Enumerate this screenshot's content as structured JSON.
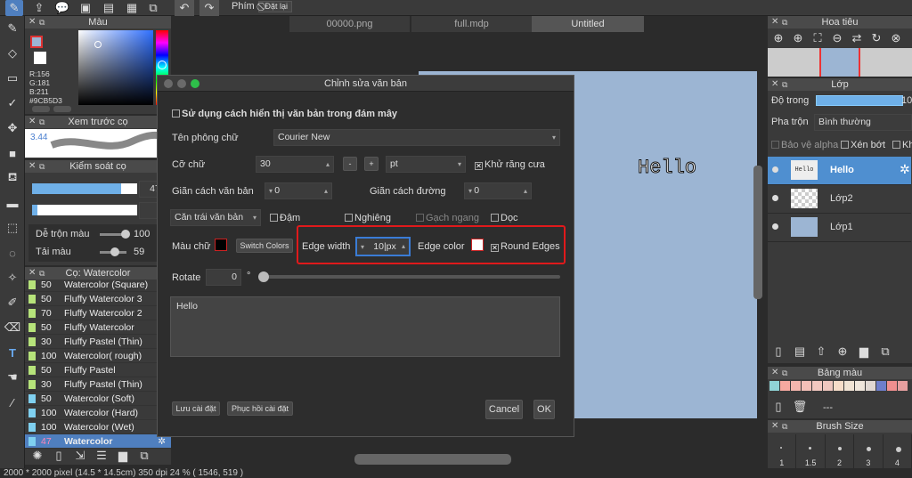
{
  "top_toolbar": {
    "snap_label": "Phím",
    "grid_button": "Đặt lại"
  },
  "tabs": [
    "00000.png",
    "full.mdp",
    "Untitled"
  ],
  "color_panel": {
    "title": "Màu",
    "r": "R:156",
    "g": "G:181",
    "b": "B:211",
    "hex": "#9CB5D3",
    "fg": "#9CB5D3",
    "bg": "#ffffff"
  },
  "preview_panel": {
    "title": "Xem trước cọ",
    "size": "3.44"
  },
  "brush_control": {
    "title": "Kiểm soát cọ",
    "size_value": "47",
    "opacity_value": "7",
    "blend_label": "Dễ trộn màu",
    "blend_value": "100",
    "load_label": "Tải màu",
    "load_value": "59",
    "size_frac": 0.85,
    "opacity_frac": 0.05,
    "blend_frac": 1.0,
    "load_frac": 0.59
  },
  "brush_list": {
    "title": "Cọ: Watercolor",
    "items": [
      {
        "n": "50",
        "name": "Watercolor (Square)"
      },
      {
        "n": "50",
        "name": "Fluffy Watercolor 3"
      },
      {
        "n": "70",
        "name": "Fluffy Watercolor 2"
      },
      {
        "n": "50",
        "name": "Fluffy Watercolor"
      },
      {
        "n": "30",
        "name": "Fluffy Pastel (Thin)"
      },
      {
        "n": "100",
        "name": "Watercolor( rough)"
      },
      {
        "n": "50",
        "name": "Fluffy Pastel"
      },
      {
        "n": "30",
        "name": "Fluffy Pastel (Thin)"
      },
      {
        "n": "50",
        "name": "Watercolor (Soft)"
      },
      {
        "n": "100",
        "name": "Watercolor (Hard)"
      },
      {
        "n": "100",
        "name": "Watercolor (Wet)"
      },
      {
        "n": "47",
        "name": "Watercolor"
      }
    ]
  },
  "status_bar": "2000 * 2000 pixel  (14.5 * 14.5cm)  350 dpi  24 %  ( 1546, 519 )",
  "canvas": {
    "text": "Hello",
    "bg": "#9CB5D3"
  },
  "dialog": {
    "title": "Chỉnh sửa văn bản",
    "cloud_font": "Sử dụng cách hiển thị văn bản trong đám mây",
    "font_label": "Tên phông chữ",
    "font_value": "Courier New",
    "size_label": "Cỡ chữ",
    "size_value": "30",
    "size_unit": "pt",
    "antialias": "Khử răng cưa",
    "char_spacing_label": "Giãn cách văn bản",
    "char_spacing_value": "0",
    "line_spacing_label": "Giãn cách đường",
    "line_spacing_value": "0",
    "align_value": "Căn trái văn bản",
    "bold": "Đậm",
    "italic": "Nghiêng",
    "strike": "Gạch ngang",
    "vertical": "Dọc",
    "color_label": "Màu chữ",
    "switch_colors": "Switch Colors",
    "edge_width_label": "Edge width",
    "edge_width_value": "10",
    "edge_width_unit": "px",
    "edge_color_label": "Edge color",
    "round_edges": "Round Edges",
    "rotate_label": "Rotate",
    "rotate_value": "0",
    "rotate_unit": "°",
    "text_content": "Hello",
    "save_settings": "Lưu cài đặt",
    "restore_settings": "Phục hồi cài đặt",
    "cancel": "Cancel",
    "ok": "OK"
  },
  "navigator": {
    "title": "Hoa tiêu"
  },
  "layers": {
    "title": "Lớp",
    "opacity_label": "Độ trong",
    "opacity_value": "10",
    "blend_label": "Pha trộn",
    "blend_value": "Bình thường",
    "protect_alpha": "Bảo vệ alpha",
    "clipping": "Xén bớt",
    "lock": "Kh",
    "items": [
      {
        "name": "Hello",
        "thumb": "Hello"
      },
      {
        "name": "Lớp2",
        "thumb": ""
      },
      {
        "name": "Lớp1",
        "thumb": ""
      }
    ]
  },
  "palette": {
    "title": "Bảng màu",
    "swatches": [
      "#8fd3d6",
      "#f7a9a0",
      "#f4b6ae",
      "#f4c0b8",
      "#f2c8c0",
      "#eec7bf",
      "#f6ddc9",
      "#f0e3d4",
      "#efe6dc",
      "#e0d8d3",
      "#6e7ecb",
      "#ef8f8f",
      "#e7a0a0"
    ],
    "label": "---"
  },
  "brush_size": {
    "title": "Brush Size",
    "values": [
      "1",
      "1.5",
      "2",
      "3",
      "4"
    ]
  }
}
